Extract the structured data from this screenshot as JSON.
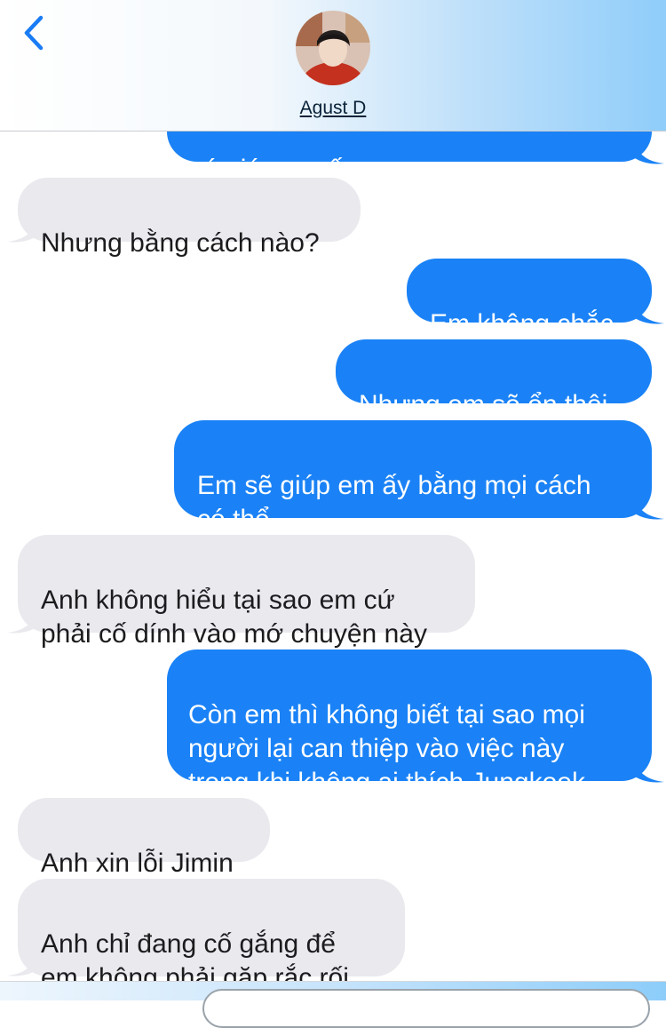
{
  "header": {
    "contact_name": "Agust D",
    "icons": {
      "back": "chevron-left-icon",
      "avatar": "contact-photo"
    }
  },
  "messages": [
    {
      "direction": "outgoing",
      "text": "có giúp em ấy"
    },
    {
      "direction": "incoming",
      "text": "Nhưng bằng cách nào?"
    },
    {
      "direction": "outgoing",
      "text": "Em không chắc"
    },
    {
      "direction": "outgoing",
      "text": "Nhưng em sẽ ổn thôi"
    },
    {
      "direction": "outgoing",
      "text": "Em sẽ giúp em ấy bằng mọi cách\ncó thể"
    },
    {
      "direction": "incoming",
      "text": "Anh không hiểu tại sao em cứ\nphải cố dính vào mớ chuyện này"
    },
    {
      "direction": "outgoing",
      "text": "Còn em thì không biết tại sao mọi\nngười lại can thiệp vào việc này\ntrong khi không ai thích Jungkook"
    },
    {
      "direction": "incoming",
      "text": "Anh xin lỗi Jimin"
    },
    {
      "direction": "incoming",
      "text": "Anh chỉ đang cố gắng để\n em không phải gặp rắc rối"
    }
  ],
  "colors": {
    "outgoing_bubble": "#1a82f6",
    "incoming_bubble": "#e9e9ee",
    "accent": "#1a7cf5"
  }
}
